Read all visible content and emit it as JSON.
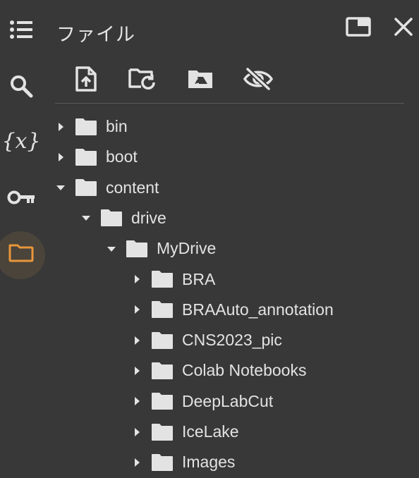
{
  "panel": {
    "title": "ファイル"
  },
  "rail": [
    {
      "icon": "list-icon"
    },
    {
      "icon": "search-icon"
    },
    {
      "icon": "variables-icon",
      "glyph": "{x}"
    },
    {
      "icon": "key-icon"
    },
    {
      "icon": "folder-icon",
      "active": true
    }
  ],
  "toolbar": [
    {
      "icon": "upload-file-icon"
    },
    {
      "icon": "refresh-folder-icon"
    },
    {
      "icon": "mount-drive-icon"
    },
    {
      "icon": "hide-files-icon"
    }
  ],
  "colors": {
    "background": "#383838",
    "text": "#e3e3e3",
    "active_accent": "#e8963b",
    "active_bg": "#4a443a"
  },
  "tree": [
    {
      "label": "bin",
      "depth": 0,
      "expanded": false
    },
    {
      "label": "boot",
      "depth": 0,
      "expanded": false
    },
    {
      "label": "content",
      "depth": 0,
      "expanded": true
    },
    {
      "label": "drive",
      "depth": 1,
      "expanded": true
    },
    {
      "label": "MyDrive",
      "depth": 2,
      "expanded": true
    },
    {
      "label": "BRA",
      "depth": 3,
      "expanded": false
    },
    {
      "label": "BRAAuto_annotation",
      "depth": 3,
      "expanded": false
    },
    {
      "label": "CNS2023_pic",
      "depth": 3,
      "expanded": false
    },
    {
      "label": "Colab Notebooks",
      "depth": 3,
      "expanded": false
    },
    {
      "label": "DeepLabCut",
      "depth": 3,
      "expanded": false
    },
    {
      "label": "IceLake",
      "depth": 3,
      "expanded": false
    },
    {
      "label": "Images",
      "depth": 3,
      "expanded": false
    }
  ]
}
